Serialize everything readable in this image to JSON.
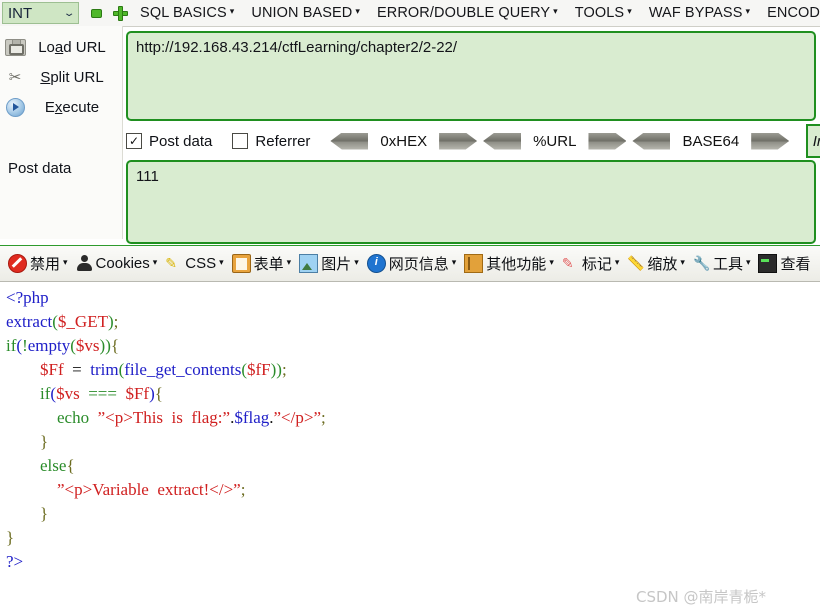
{
  "menubar": {
    "type_select": {
      "value": "INT",
      "caret": "⌄"
    },
    "remove_icon": "minus-icon",
    "add_icon": "plus-icon",
    "items": [
      {
        "label": "SQL BASICS",
        "caret": "▾"
      },
      {
        "label": "UNION BASED",
        "caret": "▾"
      },
      {
        "label": "ERROR/DOUBLE QUERY",
        "caret": "▾"
      },
      {
        "label": "TOOLS",
        "caret": "▾"
      },
      {
        "label": "WAF BYPASS",
        "caret": "▾"
      },
      {
        "label": "ENCOD",
        "caret": ""
      }
    ]
  },
  "commands": [
    {
      "name": "load-url",
      "pre": "Lo",
      "key": "a",
      "post": "d URL",
      "icon": "disk-icon"
    },
    {
      "name": "split-url",
      "pre": "",
      "key": "S",
      "post": "plit URL",
      "icon": "scissors-icon"
    },
    {
      "name": "execute",
      "pre": "E",
      "key": "x",
      "post": "ecute",
      "icon": "play-icon"
    }
  ],
  "post_data_label": "Post data",
  "url_field": {
    "value": "http://192.168.43.214/ctfLearning/chapter2/2-22/",
    "placeholder": "URL"
  },
  "options": {
    "post_data": {
      "label": "Post data",
      "checked": true,
      "check_glyph": "✓"
    },
    "referrer": {
      "label": "Referrer",
      "checked": false,
      "check_glyph": ""
    },
    "encoders": [
      {
        "label": "0xHEX"
      },
      {
        "label": "%URL"
      },
      {
        "label": "BASE64"
      }
    ],
    "insert_button": "In"
  },
  "post_field": {
    "value": "111",
    "placeholder": "Post data"
  },
  "devbar": [
    {
      "label": "禁用",
      "icon": "ban-icon",
      "caret": "▾"
    },
    {
      "label": "Cookies",
      "icon": "user-icon",
      "caret": "▾"
    },
    {
      "label": "CSS",
      "icon": "css-icon",
      "caret": "▾"
    },
    {
      "label": "表单",
      "icon": "form-icon",
      "caret": "▾"
    },
    {
      "label": "图片",
      "icon": "image-icon",
      "caret": "▾"
    },
    {
      "label": "网页信息",
      "icon": "info-icon",
      "caret": "▾"
    },
    {
      "label": "其他功能",
      "icon": "other-icon",
      "caret": "▾"
    },
    {
      "label": "标记",
      "icon": "pen-icon",
      "caret": "▾"
    },
    {
      "label": "缩放",
      "icon": "ruler-icon",
      "caret": "▾"
    },
    {
      "label": "工具",
      "icon": "tools-icon",
      "caret": "▾"
    },
    {
      "label": "查看",
      "icon": "view-icon",
      "caret": ""
    }
  ],
  "code": {
    "lines": [
      [
        {
          "t": "<?php",
          "c": "blue"
        }
      ],
      [
        {
          "t": "extract",
          "c": "blue"
        },
        {
          "t": "(",
          "c": "green"
        },
        {
          "t": "$_GET",
          "c": "red"
        },
        {
          "t": ")",
          "c": "green"
        },
        {
          "t": ";",
          "c": "olive"
        }
      ],
      [
        {
          "t": "if",
          "c": "green"
        },
        {
          "t": "(",
          "c": "blue"
        },
        {
          "t": "!",
          "c": "green"
        },
        {
          "t": "empty",
          "c": "blue"
        },
        {
          "t": "(",
          "c": "green"
        },
        {
          "t": "$vs",
          "c": "red"
        },
        {
          "t": "))",
          "c": "green"
        },
        {
          "t": "{",
          "c": "olive"
        }
      ],
      [
        {
          "t": "        ",
          "c": "dark"
        },
        {
          "t": "$Ff",
          "c": "red"
        },
        {
          "t": "  =  ",
          "c": "dark"
        },
        {
          "t": "trim",
          "c": "blue"
        },
        {
          "t": "(",
          "c": "green"
        },
        {
          "t": "file_get_contents",
          "c": "blue"
        },
        {
          "t": "(",
          "c": "green"
        },
        {
          "t": "$fF",
          "c": "red"
        },
        {
          "t": "))",
          "c": "green"
        },
        {
          "t": ";",
          "c": "olive"
        }
      ],
      [
        {
          "t": "        ",
          "c": "dark"
        },
        {
          "t": "if",
          "c": "green"
        },
        {
          "t": "(",
          "c": "blue"
        },
        {
          "t": "$vs",
          "c": "red"
        },
        {
          "t": "  ===  ",
          "c": "green"
        },
        {
          "t": "$Ff",
          "c": "red"
        },
        {
          "t": ")",
          "c": "blue"
        },
        {
          "t": "{",
          "c": "olive"
        }
      ],
      [
        {
          "t": "            ",
          "c": "dark"
        },
        {
          "t": "echo",
          "c": "green"
        },
        {
          "t": "  ",
          "c": "dark"
        },
        {
          "t": "”<p>This  is  flag:”",
          "c": "red"
        },
        {
          "t": ".",
          "c": "dark"
        },
        {
          "t": "$flag",
          "c": "blue"
        },
        {
          "t": ".",
          "c": "dark"
        },
        {
          "t": "”</p>”",
          "c": "red"
        },
        {
          "t": ";",
          "c": "olive"
        }
      ],
      [
        {
          "t": "        ",
          "c": "dark"
        },
        {
          "t": "}",
          "c": "olive"
        }
      ],
      [
        {
          "t": "        ",
          "c": "dark"
        },
        {
          "t": "else",
          "c": "green"
        },
        {
          "t": "{",
          "c": "olive"
        }
      ],
      [
        {
          "t": "            ",
          "c": "dark"
        },
        {
          "t": "”<p>Variable  extract!</>”",
          "c": "red"
        },
        {
          "t": ";",
          "c": "olive"
        }
      ],
      [
        {
          "t": "        ",
          "c": "dark"
        },
        {
          "t": "}",
          "c": "olive"
        }
      ],
      [
        {
          "t": "}",
          "c": "olive"
        }
      ],
      [
        {
          "t": "?>",
          "c": "blue"
        }
      ]
    ]
  },
  "watermark": "CSDN @南岸青栀*"
}
